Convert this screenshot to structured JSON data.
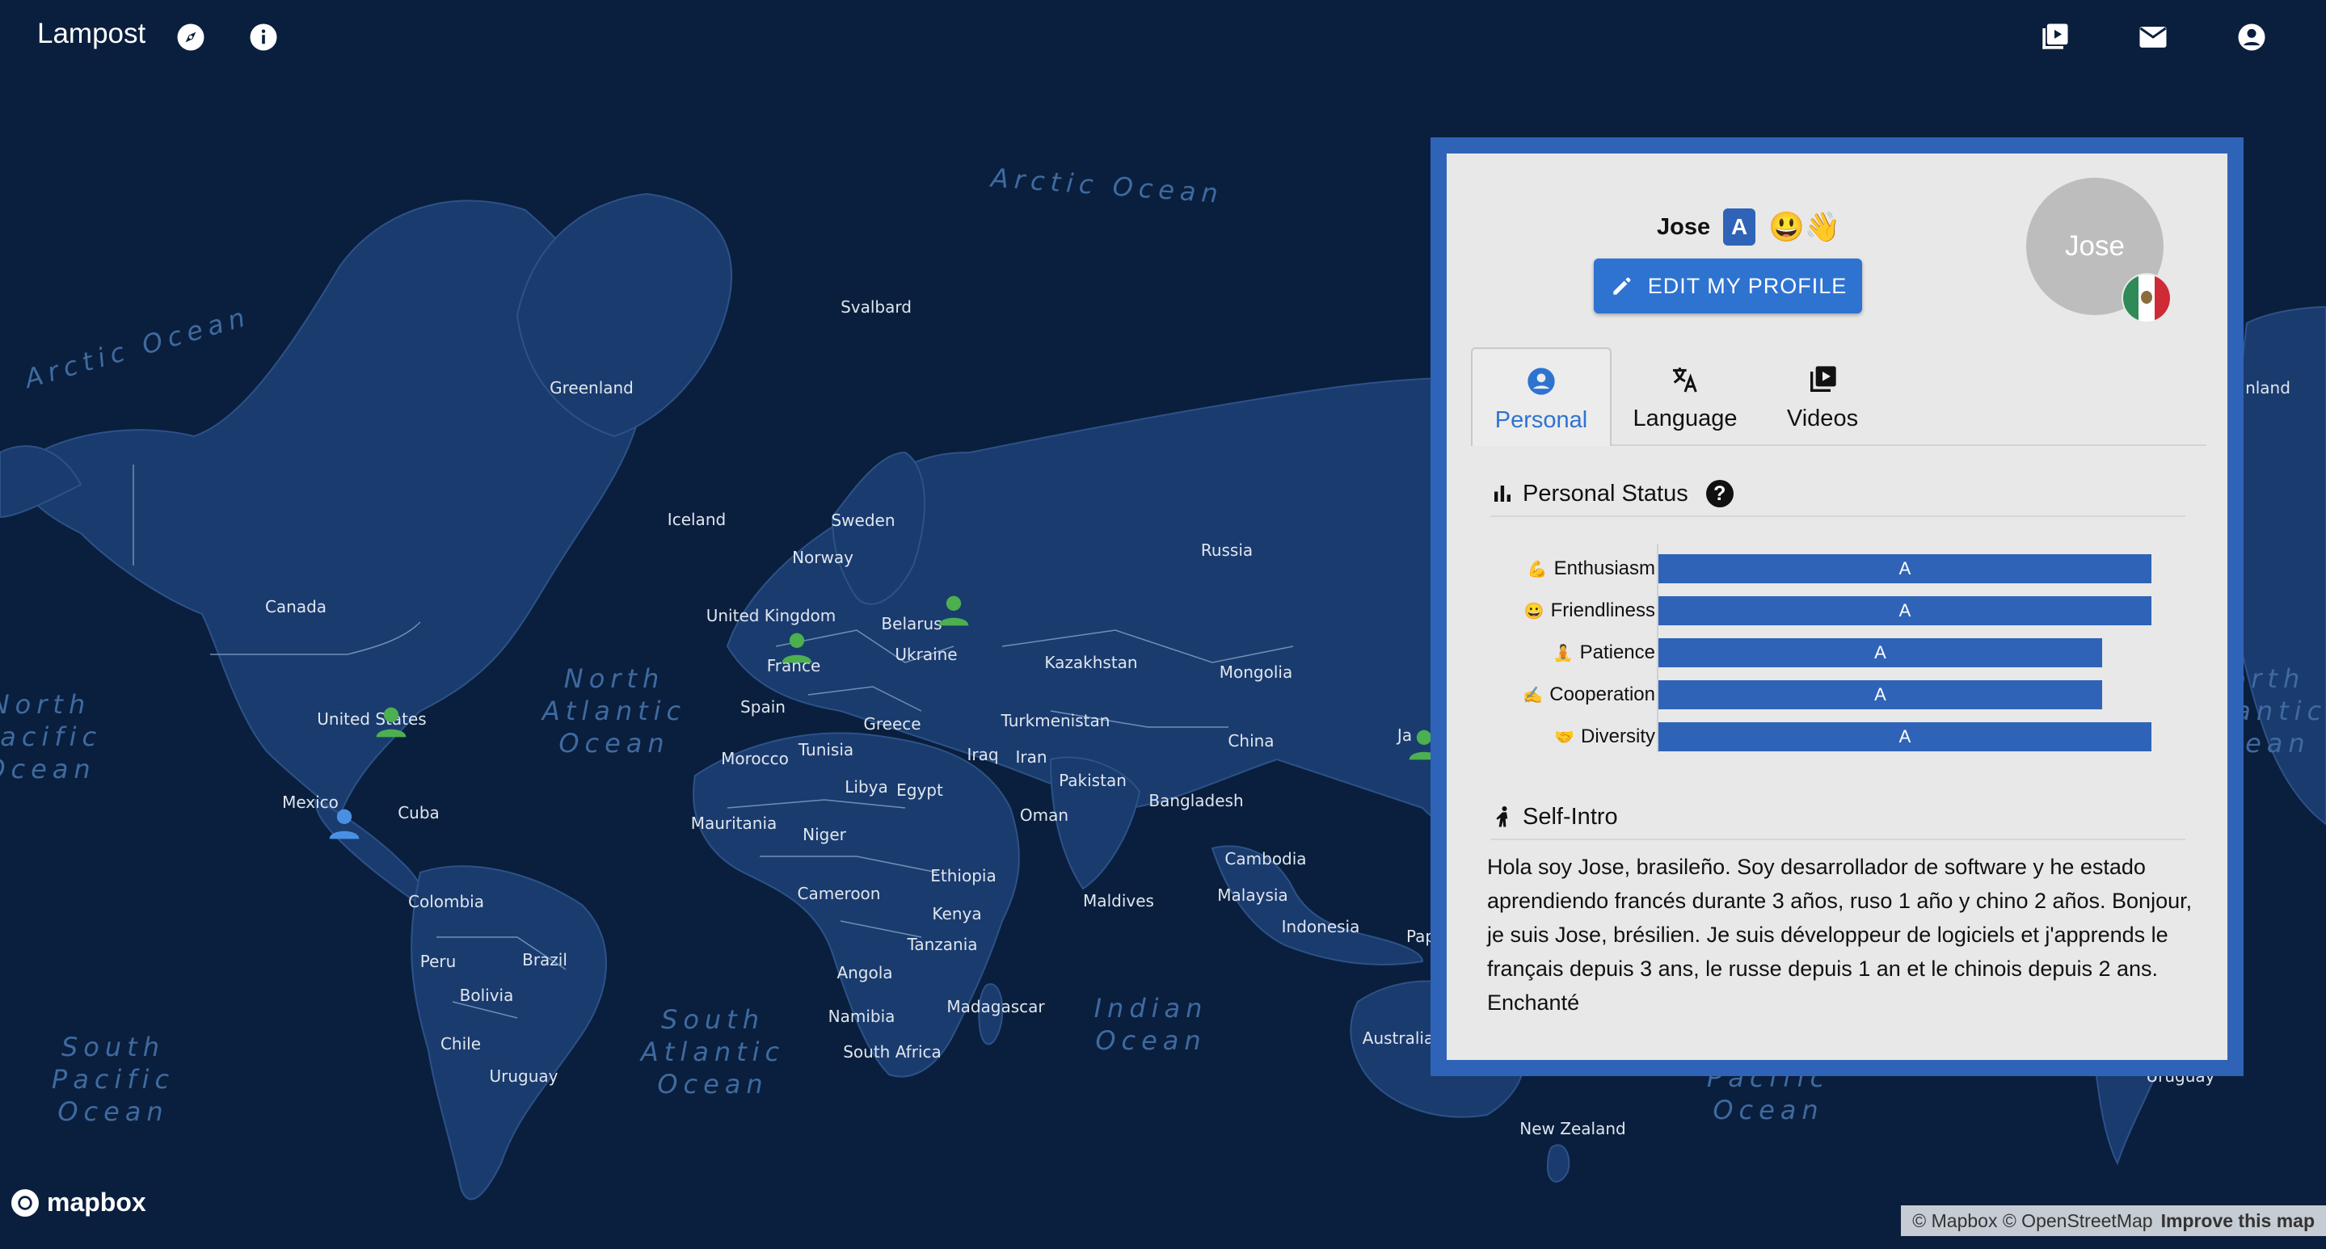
{
  "app": {
    "brand": "Lampost",
    "icons": [
      "compass-icon",
      "info-icon",
      "video-library-icon",
      "mail-icon",
      "account-icon"
    ]
  },
  "map": {
    "places": [
      {
        "name": "Svalbard"
      },
      {
        "name": "Greenland"
      },
      {
        "name": "Iceland"
      },
      {
        "name": "Sweden"
      },
      {
        "name": "Norway"
      },
      {
        "name": "Russia"
      },
      {
        "name": "Canada"
      },
      {
        "name": "United Kingdom"
      },
      {
        "name": "Belarus"
      },
      {
        "name": "Ukraine"
      },
      {
        "name": "France"
      },
      {
        "name": "Kazakhstan"
      },
      {
        "name": "Mongolia"
      },
      {
        "name": "United States"
      },
      {
        "name": "Spain"
      },
      {
        "name": "Greece"
      },
      {
        "name": "Turkmenistan"
      },
      {
        "name": "China"
      },
      {
        "name": "Tunisia"
      },
      {
        "name": "Morocco"
      },
      {
        "name": "Iraq"
      },
      {
        "name": "Iran"
      },
      {
        "name": "Libya"
      },
      {
        "name": "Egypt"
      },
      {
        "name": "Pakistan"
      },
      {
        "name": "Bangladesh"
      },
      {
        "name": "Mexico"
      },
      {
        "name": "Cuba"
      },
      {
        "name": "Oman"
      },
      {
        "name": "Mauritania"
      },
      {
        "name": "Niger"
      },
      {
        "name": "Ethiopia"
      },
      {
        "name": "Cambodia"
      },
      {
        "name": "Cameroon"
      },
      {
        "name": "Colombia"
      },
      {
        "name": "Maldives"
      },
      {
        "name": "Malaysia"
      },
      {
        "name": "Kenya"
      },
      {
        "name": "Indonesia"
      },
      {
        "name": "Tanzania"
      },
      {
        "name": "Brazil"
      },
      {
        "name": "Peru"
      },
      {
        "name": "Angola"
      },
      {
        "name": "Bolivia"
      },
      {
        "name": "Namibia"
      },
      {
        "name": "Madagascar"
      },
      {
        "name": "Chile"
      },
      {
        "name": "South Africa"
      },
      {
        "name": "Uruguay"
      },
      {
        "name": "Australia"
      },
      {
        "name": "New Zealand"
      },
      {
        "name": "Ja"
      },
      {
        "name": "Pap"
      },
      {
        "name": "nland"
      },
      {
        "name": "Uruguay"
      }
    ],
    "oceans": [
      {
        "name": "Arctic Ocean"
      },
      {
        "name": "Arctic Ocean"
      },
      {
        "name": "North\nAtlantic\nOcean"
      },
      {
        "name": "North\nPacific\nOcean"
      },
      {
        "name": "North\nAtlantic\nOcean"
      },
      {
        "name": "South\nPacific\nOcean"
      },
      {
        "name": "South\nAtlantic\nOcean"
      },
      {
        "name": "Indian\nOcean"
      },
      {
        "name": "Pacific\nOcean"
      }
    ],
    "markers": [
      {
        "color": "#4caf50"
      },
      {
        "color": "#4caf50"
      },
      {
        "color": "#4caf50"
      },
      {
        "color": "#4a90e2"
      },
      {
        "color": "#4caf50"
      }
    ]
  },
  "profile": {
    "name": "Jose",
    "level_badge": "A",
    "mood_emoji": "😃👋",
    "edit_button": "EDIT MY PROFILE",
    "avatar_text": "Jose",
    "flag": "mexico-flag",
    "tabs": [
      {
        "label": "Personal",
        "icon": "account-circle-icon",
        "active": true
      },
      {
        "label": "Language",
        "icon": "translate-icon",
        "active": false
      },
      {
        "label": "Videos",
        "icon": "video-library-icon",
        "active": false
      }
    ],
    "status_title": "Personal Status",
    "stats": [
      {
        "emoji": "💪",
        "label": "Enthusiasm",
        "grade": "A",
        "level": 1.0
      },
      {
        "emoji": "😀",
        "label": "Friendliness",
        "grade": "A",
        "level": 1.0
      },
      {
        "emoji": "🧘",
        "label": "Patience",
        "grade": "A",
        "level": 0.9
      },
      {
        "emoji": "✍️",
        "label": "Cooperation",
        "grade": "A",
        "level": 0.9
      },
      {
        "emoji": "🤝",
        "label": "Diversity",
        "grade": "A",
        "level": 1.0
      }
    ],
    "intro_title": "Self-Intro",
    "intro_text": "Hola soy Jose, brasileño. Soy desarrollador de software y he estado aprendiendo francés durante 3 años, ruso 1 año y chino 2 años. Bonjour, je suis Jose, brésilien. Je suis développeur de logiciels et j'apprends le français depuis 3 ans, le russe depuis 1 an et le chinois depuis 2 ans. Enchanté"
  },
  "footer": {
    "logo": "mapbox",
    "attribution": "© Mapbox © OpenStreetMap",
    "improve": "Improve this map"
  },
  "colors": {
    "ocean": "#0a1f3d",
    "land": "#1a3b6e",
    "accent": "#2f63b8",
    "button": "#2f73d1"
  }
}
